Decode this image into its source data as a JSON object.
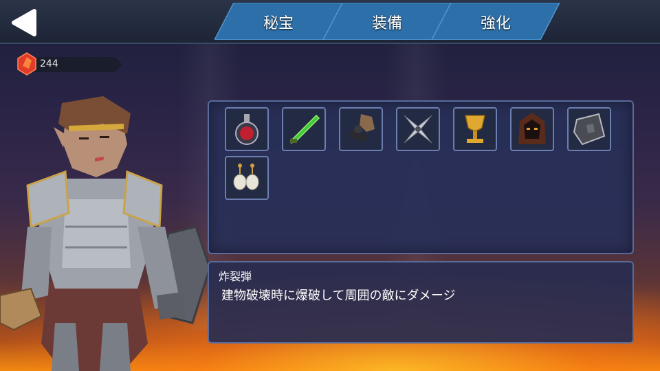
{
  "tabs": [
    {
      "label": "秘宝",
      "active": false
    },
    {
      "label": "装備",
      "active": false
    },
    {
      "label": "強化",
      "active": false
    }
  ],
  "currency": {
    "icon": "red-gem-icon",
    "amount": "244"
  },
  "items": [
    {
      "name": "bomb-potion-icon"
    },
    {
      "name": "green-poison-dagger-icon"
    },
    {
      "name": "cannonball-sack-icon"
    },
    {
      "name": "throwing-star-icon"
    },
    {
      "name": "golden-chalice-icon"
    },
    {
      "name": "hooded-mask-icon"
    },
    {
      "name": "tower-shield-icon"
    },
    {
      "name": "pearl-earrings-icon"
    }
  ],
  "description": {
    "name": "炸裂弾",
    "text": "建物破壊時に爆破して周囲の敵にダメージ"
  },
  "colors": {
    "panel": "#28305a",
    "border": "#5a6a9a",
    "tab": "#2a6ea8"
  }
}
